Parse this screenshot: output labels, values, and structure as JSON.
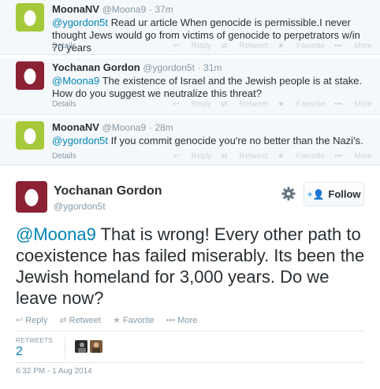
{
  "colors": {
    "link": "#0084b4",
    "muted": "#8899a6",
    "accent": "#55acee"
  },
  "replies": [
    {
      "fullname": "MoonaNV",
      "username": "@Moona9",
      "time": "37m",
      "mention": "@ygordon5t",
      "text": " Read ur article When genocide is permissible.I never thought Jews would go from victims of genocide to perpetrators w/in 70 years",
      "details": "Details",
      "avatar_bg": "#a5c93a",
      "avatar_icon": "egg-icon"
    },
    {
      "fullname": "Yochanan Gordon",
      "username": "@ygordon5t",
      "time": "31m",
      "mention": "@Moona9",
      "text": " The existence of Israel and the Jewish people is at stake. How do you suggest we neutralize this threat?",
      "details": "Details",
      "avatar_bg": "#8b2133",
      "avatar_icon": "egg-icon"
    },
    {
      "fullname": "MoonaNV",
      "username": "@Moona9",
      "time": "28m",
      "mention": "@ygordon5t",
      "text": " If you commit genocide you're no better than the Nazi's.",
      "details": "Details",
      "avatar_bg": "#a5c93a",
      "avatar_icon": "egg-icon"
    }
  ],
  "reply_actions": {
    "reply": "Reply",
    "retweet": "Retweet",
    "favorite": "Favorite",
    "more": "More"
  },
  "main": {
    "fullname": "Yochanan Gordon",
    "username": "@ygordon5t",
    "follow_label": "Follow",
    "mention": "@Moona9",
    "text": " That is wrong! Every other path to coexistence has failed miserably. Its been the Jewish homeland for 3,000 years. Do we leave now?",
    "actions": {
      "reply": "Reply",
      "retweet": "Retweet",
      "favorite": "Favorite",
      "more": "More"
    },
    "retweets_label": "RETWEETS",
    "retweets_count": "2",
    "timestamp": "6:32 PM - 1 Aug 2014",
    "avatar_bg": "#8b2133",
    "avatar_icon": "egg-icon"
  }
}
